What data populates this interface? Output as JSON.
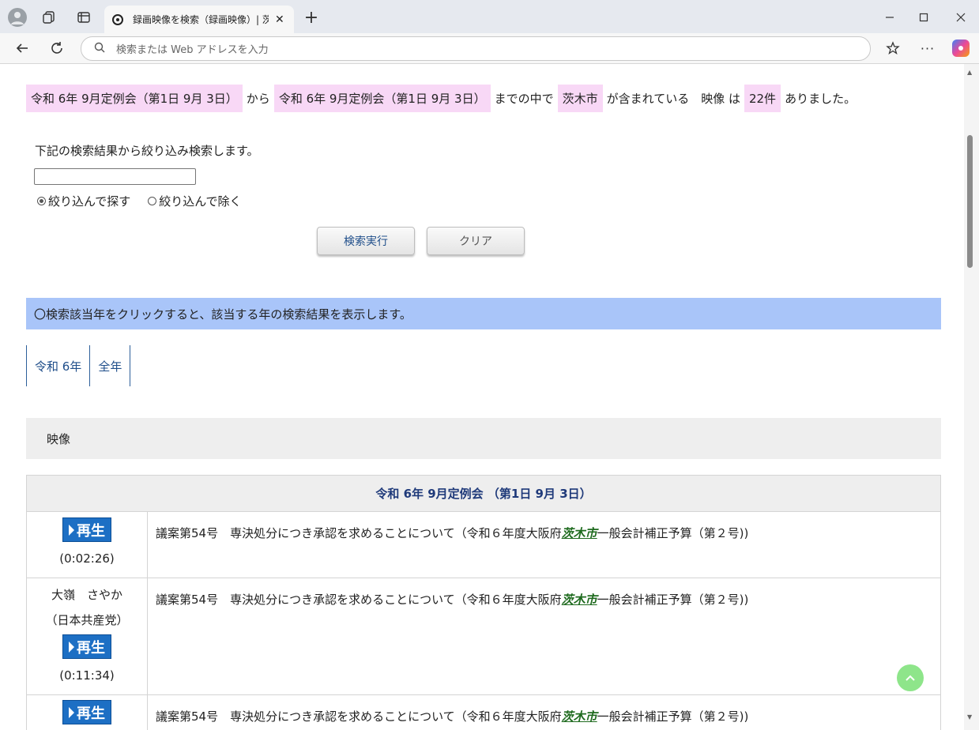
{
  "browser": {
    "tab_title": "録画映像を検索（録画映像）| 茨",
    "address_placeholder": "検索または Web アドレスを入力",
    "new_tab_label": "+",
    "tab_close_label": "✕"
  },
  "summary": {
    "from_meeting": "令和 6年 9月定例会（第1日 9月 3日）",
    "kara": "から",
    "to_meeting": "令和 6年 9月定例会（第1日 9月 3日）",
    "madeno": "までの中で",
    "keyword": "茨木市",
    "contains": "が含まれている　映像 は",
    "count": "22件",
    "arimashita": "ありました。"
  },
  "refine": {
    "label": "下記の検索結果から絞り込み検索します。",
    "input_value": "",
    "option_include": "絞り込んで探す",
    "option_exclude": "絞り込んで除く",
    "search_button": "検索実行",
    "clear_button": "クリア"
  },
  "info_bar": "〇検索該当年をクリックすると、該当する年の検索結果を表示します。",
  "year_tabs": [
    "令和 6年",
    "全年"
  ],
  "video_section": "映像",
  "results": {
    "meeting_header": "令和 6年 9月定例会 （第1日 9月 3日）",
    "play_label": "再生",
    "rows": [
      {
        "speaker": "",
        "party": "",
        "duration": "(0:02:26)",
        "text_before": "議案第54号　専決処分につき承認を求めることについて（令和６年度大阪府",
        "keyword": "茨木市",
        "text_after": "一般会計補正予算（第２号))"
      },
      {
        "speaker": "大嶺　さやか",
        "party": "（日本共産党）",
        "duration": "(0:11:34)",
        "text_before": "議案第54号　専決処分につき承認を求めることについて（令和６年度大阪府",
        "keyword": "茨木市",
        "text_after": "一般会計補正予算（第２号))"
      },
      {
        "speaker": "",
        "party": "",
        "duration": "",
        "text_before": "議案第54号　専決処分につき承認を求めることについて（令和６年度大阪府",
        "keyword": "茨木市",
        "text_after": "一般会計補正予算（第２号))"
      }
    ]
  },
  "colors": {
    "highlight": "#f8d8f6",
    "info_bar": "#a9c5f9",
    "play_button": "#1d6fc4",
    "keyword": "#1f6b1f",
    "back_to_top": "#8ee58a"
  }
}
